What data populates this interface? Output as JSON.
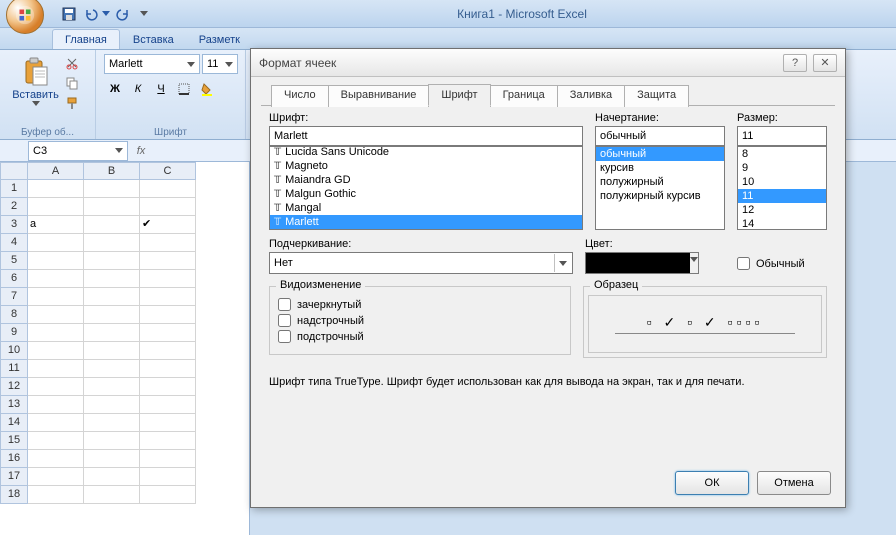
{
  "title": "Книга1  -  Microsoft Excel",
  "qat": {
    "save": "save",
    "undo": "undo",
    "redo": "redo"
  },
  "ribbon_tabs": [
    "Главная",
    "Вставка",
    "Разметк"
  ],
  "ribbon": {
    "group_clipboard": "Буфер об...",
    "paste": "Вставить",
    "group_font": "Шрифт",
    "font_name": "Marlett",
    "font_size": "11",
    "bold": "Ж",
    "italic": "К",
    "underline": "Ч"
  },
  "namebox": "C3",
  "columns": [
    "A",
    "B",
    "C"
  ],
  "rows": [
    "1",
    "2",
    "3",
    "4",
    "5",
    "6",
    "7",
    "8",
    "9",
    "10",
    "11",
    "12",
    "13",
    "14",
    "15",
    "16",
    "17",
    "18"
  ],
  "cells": {
    "A3": "a",
    "C3": "✔"
  },
  "dialog": {
    "title": "Формат ячеек",
    "tabs": [
      "Число",
      "Выравнивание",
      "Шрифт",
      "Граница",
      "Заливка",
      "Защита"
    ],
    "active_tab": 2,
    "font_label": "Шрифт:",
    "font_value": "Marlett",
    "font_list": [
      "Lucida Sans Unicode",
      "Magneto",
      "Maiandra GD",
      "Malgun Gothic",
      "Mangal",
      "Marlett"
    ],
    "font_selected": "Marlett",
    "style_label": "Начертание:",
    "style_value": "обычный",
    "style_list": [
      "обычный",
      "курсив",
      "полужирный",
      "полужирный курсив"
    ],
    "style_selected": "обычный",
    "size_label": "Размер:",
    "size_value": "11",
    "size_list": [
      "8",
      "9",
      "10",
      "11",
      "12",
      "14"
    ],
    "size_selected": "11",
    "underline_label": "Подчеркивание:",
    "underline_value": "Нет",
    "color_label": "Цвет:",
    "normal_chk": "Обычный",
    "effects_title": "Видоизменение",
    "eff_strike": "зачеркнутый",
    "eff_super": "надстрочный",
    "eff_sub": "подстрочный",
    "sample_title": "Образец",
    "sample_text": "▫ ✓ ▫ ✓ ▫▫▫▫",
    "note": "Шрифт типа TrueType. Шрифт будет использован как для вывода на экран, так и для печати.",
    "ok": "ОК",
    "cancel": "Отмена"
  }
}
